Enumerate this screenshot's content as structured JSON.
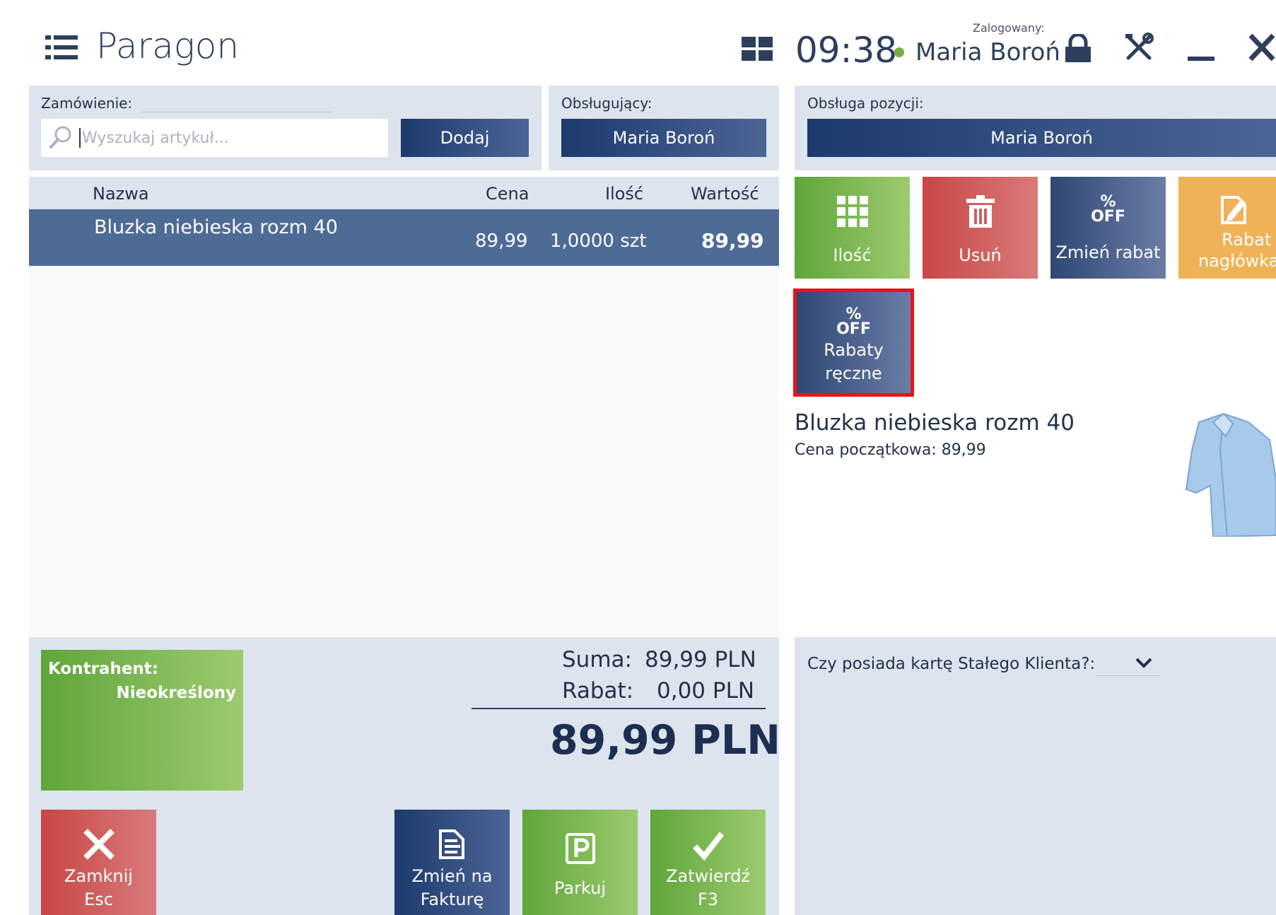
{
  "header": {
    "title": "Paragon",
    "clock": "09:38",
    "logged_label": "Zalogowany:",
    "user": "Maria Boroń"
  },
  "order": {
    "label": "Zamówienie:",
    "search_placeholder": "Wyszukaj artykuł...",
    "add_label": "Dodaj"
  },
  "cashier": {
    "label": "Obsługujący:",
    "value": "Maria Boroń"
  },
  "item_service": {
    "label": "Obsługa pozycji:",
    "value": "Maria Boroń"
  },
  "table": {
    "headers": {
      "name": "Nazwa",
      "price": "Cena",
      "qty": "Ilość",
      "value": "Wartość"
    },
    "rows": [
      {
        "name": "Bluzka niebieska rozm 40",
        "price": "89,99",
        "qty": "1,0000 szt",
        "value": "89,99"
      }
    ]
  },
  "actions": {
    "qty": "Ilość",
    "delete": "Usuń",
    "change_discount": "Zmień rabat",
    "header_discount_1": "Rabat",
    "header_discount_2": "nagłówka",
    "manual_discounts_1": "Rabaty",
    "manual_discounts_2": "ręczne",
    "off_percent": "%",
    "off_text": "OFF"
  },
  "product": {
    "name": "Bluzka niebieska rozm 40",
    "initial_price": "Cena początkowa: 89,99"
  },
  "customer": {
    "label": "Kontrahent:",
    "value": "Nieokreślony"
  },
  "totals": {
    "sum_label": "Suma:",
    "sum_value": "89,99 PLN",
    "discount_label": "Rabat:",
    "discount_value": "0,00 PLN",
    "total": "89,99 PLN"
  },
  "bottom_buttons": {
    "close_1": "Zamknij",
    "close_2": "Esc",
    "invoice_1": "Zmień na",
    "invoice_2": "Fakturę",
    "park": "Parkuj",
    "confirm_1": "Zatwierdź",
    "confirm_2": "F3"
  },
  "loyalty": {
    "label": "Czy posiada kartę Stałego Klienta?:"
  },
  "colors": {
    "navy": "#1d3a6d",
    "green": "#76b043",
    "red": "#c94646",
    "orange": "#f0b257",
    "selected_row": "#4e6b96",
    "highlight": "#e8141c"
  }
}
